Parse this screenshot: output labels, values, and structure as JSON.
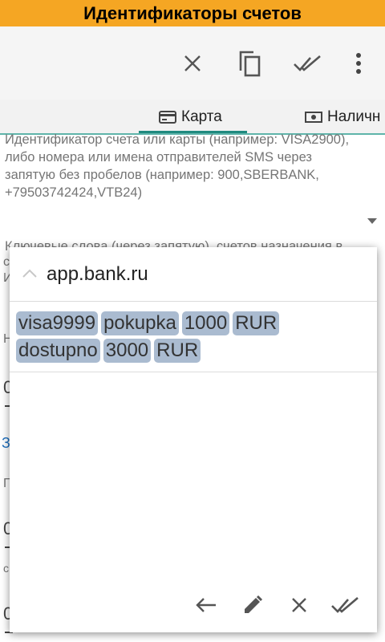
{
  "title": "Идентификаторы счетов",
  "toolbar": {
    "close": "close-icon",
    "copy": "copy-icon",
    "done_all": "done-all-icon",
    "more": "more-vert-icon"
  },
  "tabs": [
    {
      "label": "Карта",
      "icon": "credit-card-icon",
      "selected": true
    },
    {
      "label": "Наличн",
      "icon": "cash-icon",
      "selected": false
    }
  ],
  "colors": {
    "title_bar": "#f5a623",
    "accent": "#1f8a7f",
    "highlight": "#aabbd0"
  },
  "background_form": {
    "identifier_hint": [
      "Идентификатор счета или карты (например: VISA2900),",
      "либо номера или имена отправителей SMS через",
      "запятую без пробелов (например: 900,SBERBANK,",
      "+79503742424,VTB24)"
    ],
    "keywords_hint": "Ключевые слова (через запятую), счетов назначения в",
    "frag_c": "с",
    "frag_i": "И",
    "frag_n": "Н",
    "frag_0a": "0",
    "frag_z": "З",
    "frag_p": "П",
    "frag_0b": "0",
    "frag_c2": "с",
    "frag_0c": "0"
  },
  "popup": {
    "sender": "app.bank.ru",
    "words": [
      "visa9999",
      "pokupka",
      "1000",
      "RUR",
      "dostupno",
      "3000",
      "RUR"
    ],
    "buttons": [
      "back-arrow-icon",
      "edit-icon",
      "close-icon",
      "done-all-icon"
    ]
  }
}
